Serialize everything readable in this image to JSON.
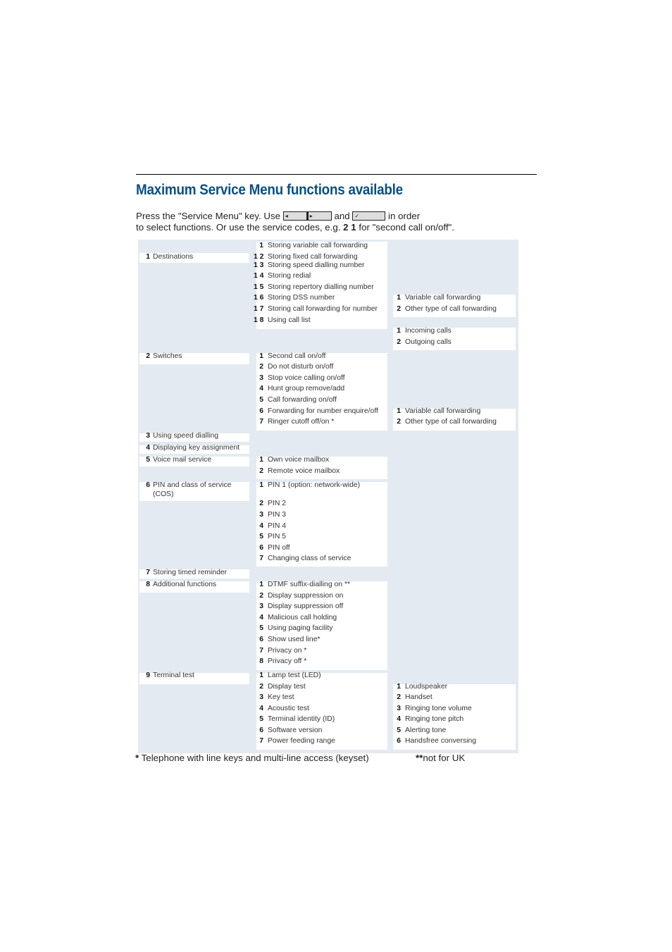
{
  "page_title": "Maximum Service Menu functions available",
  "intro": {
    "line1_before": "Press the \"Service Menu\" key. Use",
    "key_left_icon": "◂",
    "key_right_icon": "▸",
    "and": "and",
    "key_ok_icon": "✓",
    "line1_after": "in order",
    "line2_before": "to select functions. Or use the service codes, e.g.",
    "example_code": "2 1",
    "line2_after": "for \"second call on/off\"."
  },
  "menu": {
    "level1": [
      {
        "num": "1",
        "label": "Destinations"
      },
      {
        "num": "2",
        "label": "Switches"
      },
      {
        "num": "3",
        "label": "Using speed dialling"
      },
      {
        "num": "4",
        "label": "Displaying key assignment"
      },
      {
        "num": "5",
        "label": "Voice mail service"
      },
      {
        "num": "6",
        "label": "PIN and class of service (COS)"
      },
      {
        "num": "7",
        "label": "Storing timed reminder"
      },
      {
        "num": "8",
        "label": "Additional functions"
      },
      {
        "num": "9",
        "label": "Terminal test"
      }
    ],
    "destinations": [
      {
        "num": "1",
        "label": "Storing variable call forwarding"
      },
      {
        "num": "1 2",
        "label": "Storing fixed call forwarding"
      },
      {
        "num": "1 3",
        "label": "Storing speed dialling number"
      },
      {
        "num": "1 4",
        "label": "Storing redial"
      },
      {
        "num": "1 5",
        "label": "Storing repertory dialling number"
      },
      {
        "num": "1 6",
        "label": "Storing DSS number"
      },
      {
        "num": "1 7",
        "label": "Storing call forwarding for number"
      },
      {
        "num": "1 8",
        "label": "Using call list"
      }
    ],
    "destinations_sub_forwarding": [
      {
        "num": "1",
        "label": "Variable call forwarding"
      },
      {
        "num": "2",
        "label": "Other type of call forwarding"
      }
    ],
    "destinations_sub_calllist": [
      {
        "num": "1",
        "label": "Incoming calls"
      },
      {
        "num": "2",
        "label": "Outgoing calls"
      }
    ],
    "switches": [
      {
        "num": "1",
        "label": "Second call on/off"
      },
      {
        "num": "2",
        "label": "Do not disturb on/off"
      },
      {
        "num": "3",
        "label": "Stop voice calling on/off"
      },
      {
        "num": "4",
        "label": "Hunt group remove/add"
      },
      {
        "num": "5",
        "label": "Call forwarding on/off"
      },
      {
        "num": "6",
        "label": "Forwarding for number enquire/off"
      },
      {
        "num": "7",
        "label": "Ringer cutoff off/on *"
      }
    ],
    "switches_sub": [
      {
        "num": "1",
        "label": "Variable call forwarding"
      },
      {
        "num": "2",
        "label": "Other type of call forwarding"
      }
    ],
    "voicemail": [
      {
        "num": "1",
        "label": "Own voice mailbox"
      },
      {
        "num": "2",
        "label": "Remote voice mailbox"
      }
    ],
    "pin": [
      {
        "num": "1",
        "label": "PIN 1 (option: network-wide)"
      },
      {
        "num": "2",
        "label": "PIN 2"
      },
      {
        "num": "3",
        "label": "PIN 3"
      },
      {
        "num": "4",
        "label": "PIN 4"
      },
      {
        "num": "5",
        "label": "PIN 5"
      },
      {
        "num": "6",
        "label": "PIN off"
      },
      {
        "num": "7",
        "label": "Changing class of service"
      }
    ],
    "additional": [
      {
        "num": "1",
        "label": "DTMF suffix-dialling on **"
      },
      {
        "num": "2",
        "label": "Display suppression on"
      },
      {
        "num": "3",
        "label": "Display suppression off"
      },
      {
        "num": "4",
        "label": "Malicious call holding"
      },
      {
        "num": "5",
        "label": "Using paging facility"
      },
      {
        "num": "6",
        "label": "Show used line*"
      },
      {
        "num": "7",
        "label": "Privacy on *"
      },
      {
        "num": "8",
        "label": "Privacy off *"
      }
    ],
    "terminal": [
      {
        "num": "1",
        "label": "Lamp test (LED)"
      },
      {
        "num": "2",
        "label": "Display test"
      },
      {
        "num": "3",
        "label": "Key test"
      },
      {
        "num": "4",
        "label": "Acoustic test"
      },
      {
        "num": "5",
        "label": "Terminal identity (ID)"
      },
      {
        "num": "6",
        "label": "Software version"
      },
      {
        "num": "7",
        "label": "Power feeding range"
      }
    ],
    "acoustic_sub": [
      {
        "num": "1",
        "label": "Loudspeaker"
      },
      {
        "num": "2",
        "label": "Handset"
      },
      {
        "num": "3",
        "label": "Ringing tone volume"
      },
      {
        "num": "4",
        "label": "Ringing tone pitch"
      },
      {
        "num": "5",
        "label": "Alerting tone"
      },
      {
        "num": "6",
        "label": "Handsfree conversing"
      }
    ]
  },
  "footnotes": {
    "star_mark": "*",
    "star_text": "Telephone with line keys and multi-line access (keyset)",
    "double_star_mark": "**",
    "double_star_text": "not for UK"
  }
}
